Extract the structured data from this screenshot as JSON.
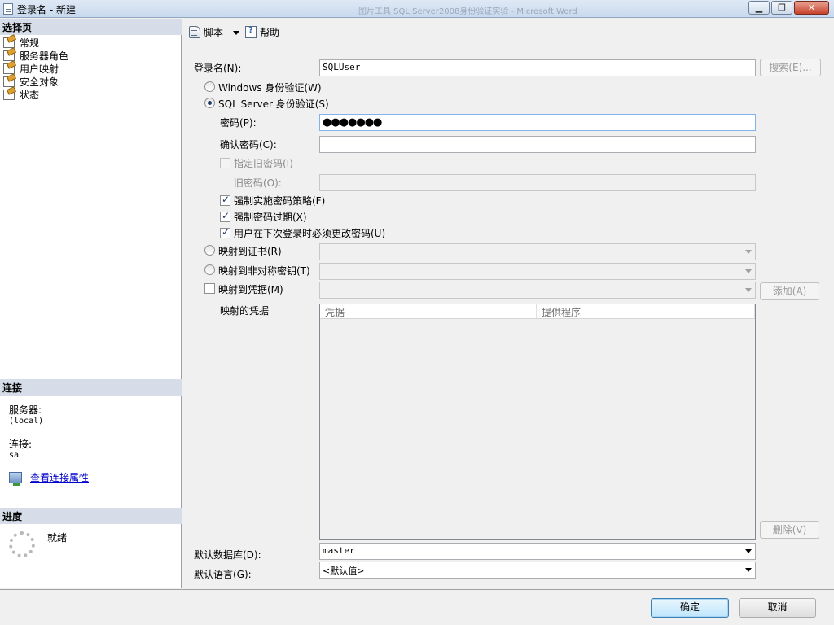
{
  "window": {
    "title": "登录名 - 新建",
    "background_text": "图片工具    SQL Server2008身份验证实验 - Microsoft Word"
  },
  "left": {
    "select_page_header": "选择页",
    "pages": [
      "常规",
      "服务器角色",
      "用户映射",
      "安全对象",
      "状态"
    ],
    "connection_header": "连接",
    "server_label": "服务器:",
    "server_value": "(local)",
    "connection_label": "连接:",
    "connection_value": "sa",
    "view_props_link": "查看连接属性",
    "progress_header": "进度",
    "progress_status": "就绪"
  },
  "toolbar": {
    "script_label": "脚本",
    "help_label": "帮助"
  },
  "form": {
    "login_name_label": "登录名(N):",
    "login_name_value": "SQLUser",
    "search_button": "搜索(E)...",
    "windows_auth": "Windows 身份验证(W)",
    "sql_auth": "SQL Server 身份验证(S)",
    "password_label": "密码(P):",
    "password_value": "●●●●●●●",
    "confirm_password_label": "确认密码(C):",
    "confirm_password_value": "",
    "specify_old_password": "指定旧密码(I)",
    "old_password_label": "旧密码(O):",
    "enforce_policy": "强制实施密码策略(F)",
    "enforce_expiration": "强制密码过期(X)",
    "must_change": "用户在下次登录时必须更改密码(U)",
    "map_certificate": "映射到证书(R)",
    "map_asymmetric_key": "映射到非对称密钥(T)",
    "map_credential": "映射到凭据(M)",
    "add_button": "添加(A)",
    "mapped_credentials_label": "映射的凭据",
    "grid_columns": [
      "凭据",
      "提供程序"
    ],
    "remove_button": "删除(V)",
    "default_db_label": "默认数据库(D):",
    "default_db_value": "master",
    "default_lang_label": "默认语言(G):",
    "default_lang_value": "<默认值>"
  },
  "footer": {
    "ok_button": "确定",
    "cancel_button": "取消"
  }
}
